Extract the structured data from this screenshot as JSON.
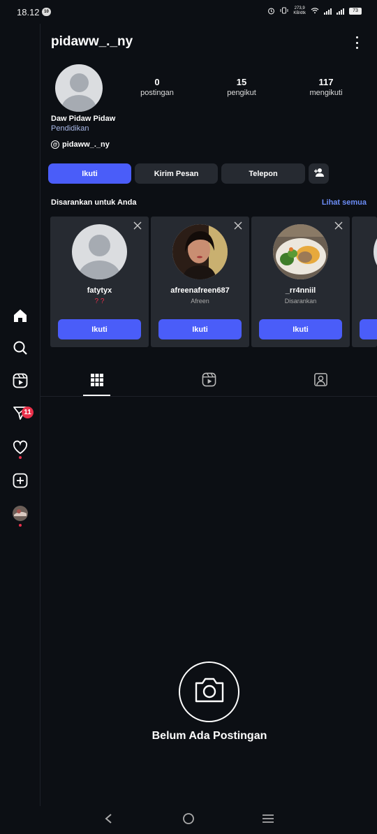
{
  "status_bar": {
    "time": "18.12",
    "notification_count": "10",
    "net_speed": "273,9\nKB/dtk",
    "battery": "73"
  },
  "header": {
    "username": "pidaww_._ny"
  },
  "profile": {
    "stats": [
      {
        "value": "0",
        "label": "postingan"
      },
      {
        "value": "15",
        "label": "pengikut"
      },
      {
        "value": "117",
        "label": "mengikuti"
      }
    ],
    "full_name": "Daw Pidaw Pidaw",
    "category": "Pendidikan",
    "threads_handle": "pidaww_._ny"
  },
  "actions": {
    "follow": "Ikuti",
    "message": "Kirim Pesan",
    "call": "Telepon"
  },
  "suggestions": {
    "title": "Disarankan untuk Anda",
    "see_all": "Lihat semua",
    "cards": [
      {
        "name": "fatytyx",
        "subtitle": "? ?",
        "button": "Ikuti"
      },
      {
        "name": "afreenafreen687",
        "subtitle": "Afreen",
        "button": "Ikuti"
      },
      {
        "name": "_rr4nniil",
        "subtitle": "Disarankan",
        "button": "Ikuti"
      }
    ]
  },
  "sidebar": {
    "messages_badge": "11"
  },
  "empty_state": {
    "text": "Belum Ada Postingan"
  },
  "colors": {
    "background": "#0c0f14",
    "accent": "#4a5df9",
    "card": "#262a31",
    "badge": "#e8304a",
    "link": "#6b8cf5"
  }
}
